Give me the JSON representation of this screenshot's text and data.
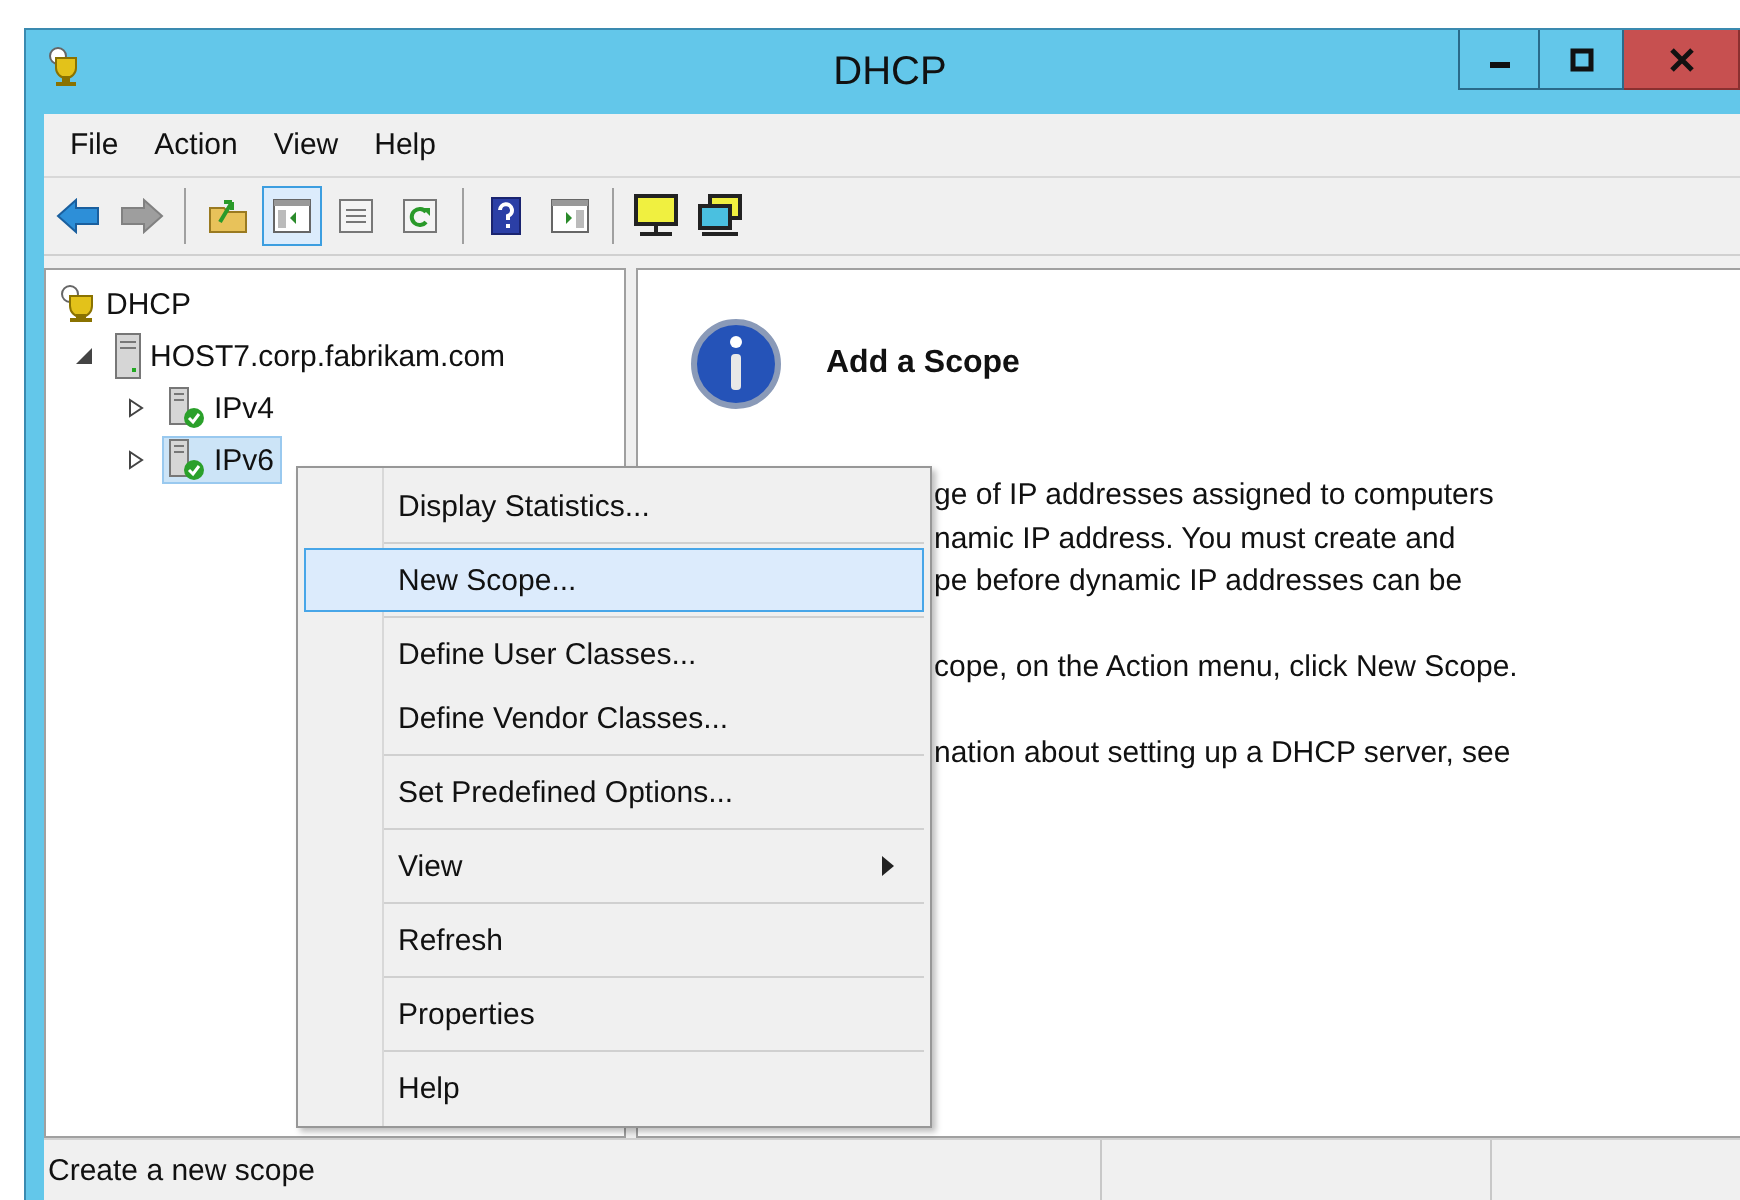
{
  "window": {
    "title": "DHCP"
  },
  "menu_bar": [
    "File",
    "Action",
    "View",
    "Help"
  ],
  "toolbar_groups": [
    [
      {
        "kind": "back",
        "disabled": false,
        "pressed": false
      },
      {
        "kind": "forward",
        "disabled": true,
        "pressed": false
      }
    ],
    [
      {
        "kind": "up",
        "disabled": false,
        "pressed": false
      },
      {
        "kind": "tree",
        "disabled": false,
        "pressed": true
      },
      {
        "kind": "export",
        "disabled": false,
        "pressed": false
      },
      {
        "kind": "refresh",
        "disabled": false,
        "pressed": false
      }
    ],
    [
      {
        "kind": "help",
        "disabled": false,
        "pressed": false
      },
      {
        "kind": "action-pane",
        "disabled": false,
        "pressed": false
      }
    ],
    [
      {
        "kind": "monitor",
        "disabled": false,
        "pressed": false
      },
      {
        "kind": "monitors",
        "disabled": false,
        "pressed": false
      }
    ]
  ],
  "tree": [
    {
      "label": "DHCP",
      "selected": false,
      "children": [
        {
          "label": "HOST7.corp.fabrikam.com",
          "expanded": true,
          "selected": false,
          "children": [
            {
              "label": "IPv4",
              "expanded": false,
              "selected": false
            },
            {
              "label": "IPv6",
              "expanded": false,
              "selected": true
            }
          ]
        }
      ]
    }
  ],
  "details": {
    "heading": "Add a Scope",
    "paragraphs": [
      [
        "ge of IP addresses assigned to computers",
        "namic IP address. You must create and",
        "pe before dynamic IP addresses can be"
      ],
      [
        "cope, on the Action menu, click New Scope."
      ],
      [
        "nation about setting up a DHCP server, see"
      ]
    ]
  },
  "context_menu": [
    [
      {
        "label": "Display Statistics...",
        "selected": false,
        "submenu": false
      }
    ],
    [
      {
        "label": "New Scope...",
        "selected": true,
        "submenu": false
      }
    ],
    [
      {
        "label": "Define User Classes...",
        "selected": false,
        "submenu": false
      },
      {
        "label": "Define Vendor Classes...",
        "selected": false,
        "submenu": false
      }
    ],
    [
      {
        "label": "Set Predefined Options...",
        "selected": false,
        "submenu": false
      }
    ],
    [
      {
        "label": "View",
        "selected": false,
        "submenu": true
      }
    ],
    [
      {
        "label": "Refresh",
        "selected": false,
        "submenu": false
      }
    ],
    [
      {
        "label": "Properties",
        "selected": false,
        "submenu": false
      }
    ],
    [
      {
        "label": "Help",
        "selected": false,
        "submenu": false
      }
    ]
  ],
  "status_bar": {
    "text": "Create a new scope"
  }
}
